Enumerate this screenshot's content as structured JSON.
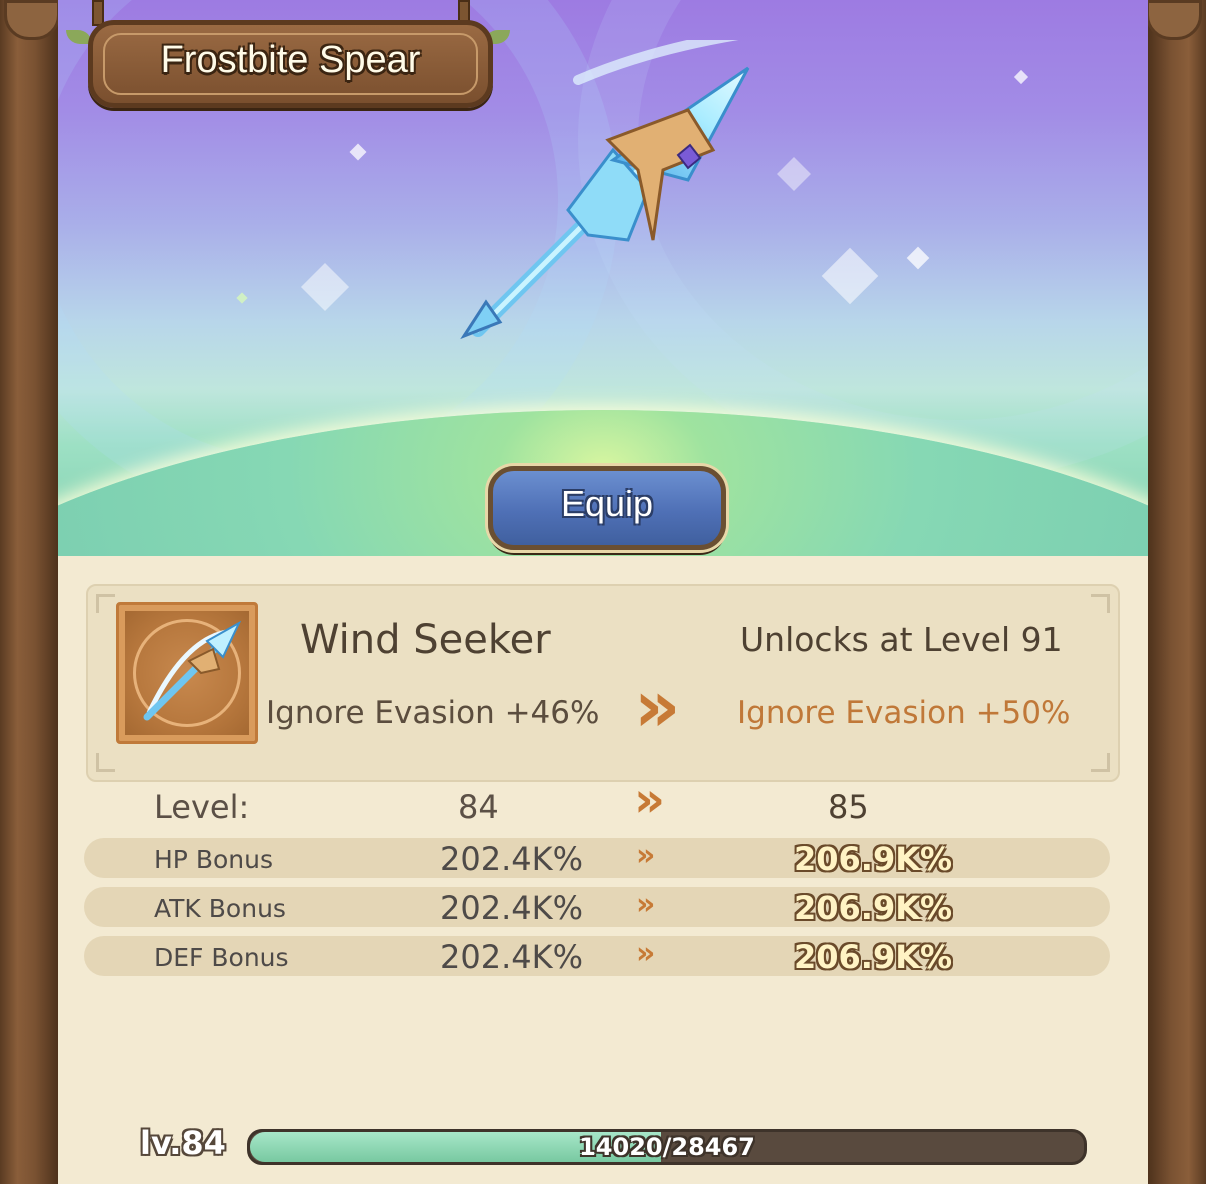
{
  "item": {
    "title": "Frostbite Spear",
    "equip_label": "Equip"
  },
  "skill": {
    "name": "Wind Seeker",
    "current_effect": "Ignore Evasion +46%",
    "unlock_text": "Unlocks at Level 91",
    "next_effect": "Ignore Evasion +50%",
    "arrow": "»"
  },
  "level": {
    "label": "Level:",
    "current": "84",
    "next": "85"
  },
  "stats": [
    {
      "name": "HP Bonus",
      "current": "202.4K%",
      "next": "206.9K%"
    },
    {
      "name": "ATK Bonus",
      "current": "202.4K%",
      "next": "206.9K%"
    },
    {
      "name": "DEF Bonus",
      "current": "202.4K%",
      "next": "206.9K%"
    }
  ],
  "progress": {
    "level_label": "lv.84",
    "text": "14020/28467",
    "current": 14020,
    "max": 28467
  },
  "colors": {
    "accent_orange": "#c07838",
    "equip_blue": "#4f70b6",
    "xp_green": "#78c9a1"
  },
  "icons": {
    "weapon": "ice-spear-icon",
    "skill": "wind-seeker-skill-icon",
    "arrow": "double-chevron-right-icon"
  }
}
